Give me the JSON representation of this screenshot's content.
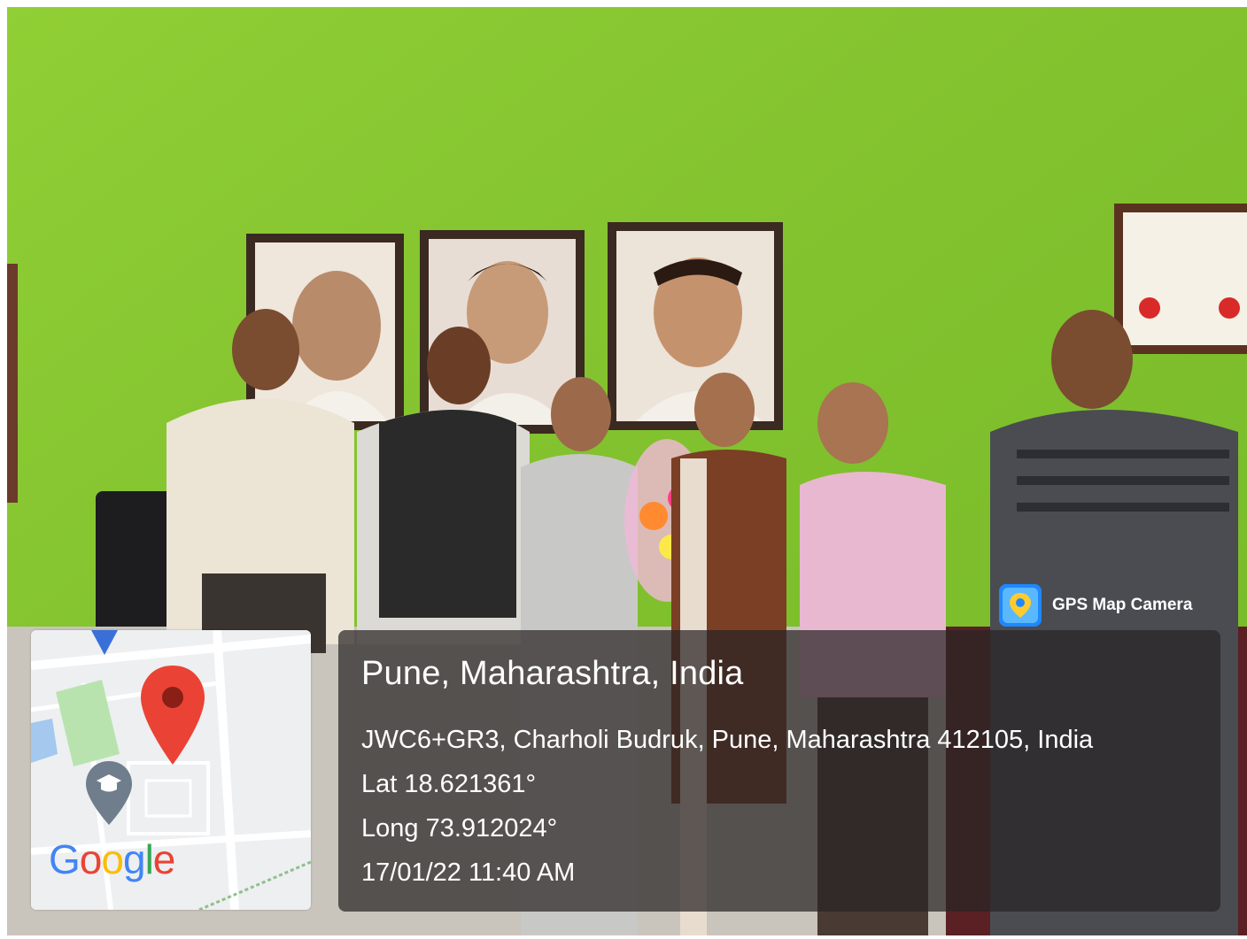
{
  "photo": {
    "wall_color": "#86c830"
  },
  "map_thumbnail": {
    "logo_text": "Google",
    "logo_letters": [
      {
        "ch": "G",
        "color": "#4285f4"
      },
      {
        "ch": "o",
        "color": "#ea4335"
      },
      {
        "ch": "o",
        "color": "#fbbc05"
      },
      {
        "ch": "g",
        "color": "#4285f4"
      },
      {
        "ch": "l",
        "color": "#34a853"
      },
      {
        "ch": "e",
        "color": "#ea4335"
      }
    ],
    "pin_color": "#ea4335",
    "marker_icon": "graduation-cap-icon"
  },
  "stamp": {
    "app_name": "GPS Map Camera",
    "location_title": "Pune, Maharashtra, India",
    "address": "JWC6+GR3, Charholi Budruk, Pune, Maharashtra 412105, India",
    "latitude": "Lat 18.621361°",
    "longitude": "Long 73.912024°",
    "datetime": "17/01/22 11:40 AM"
  }
}
